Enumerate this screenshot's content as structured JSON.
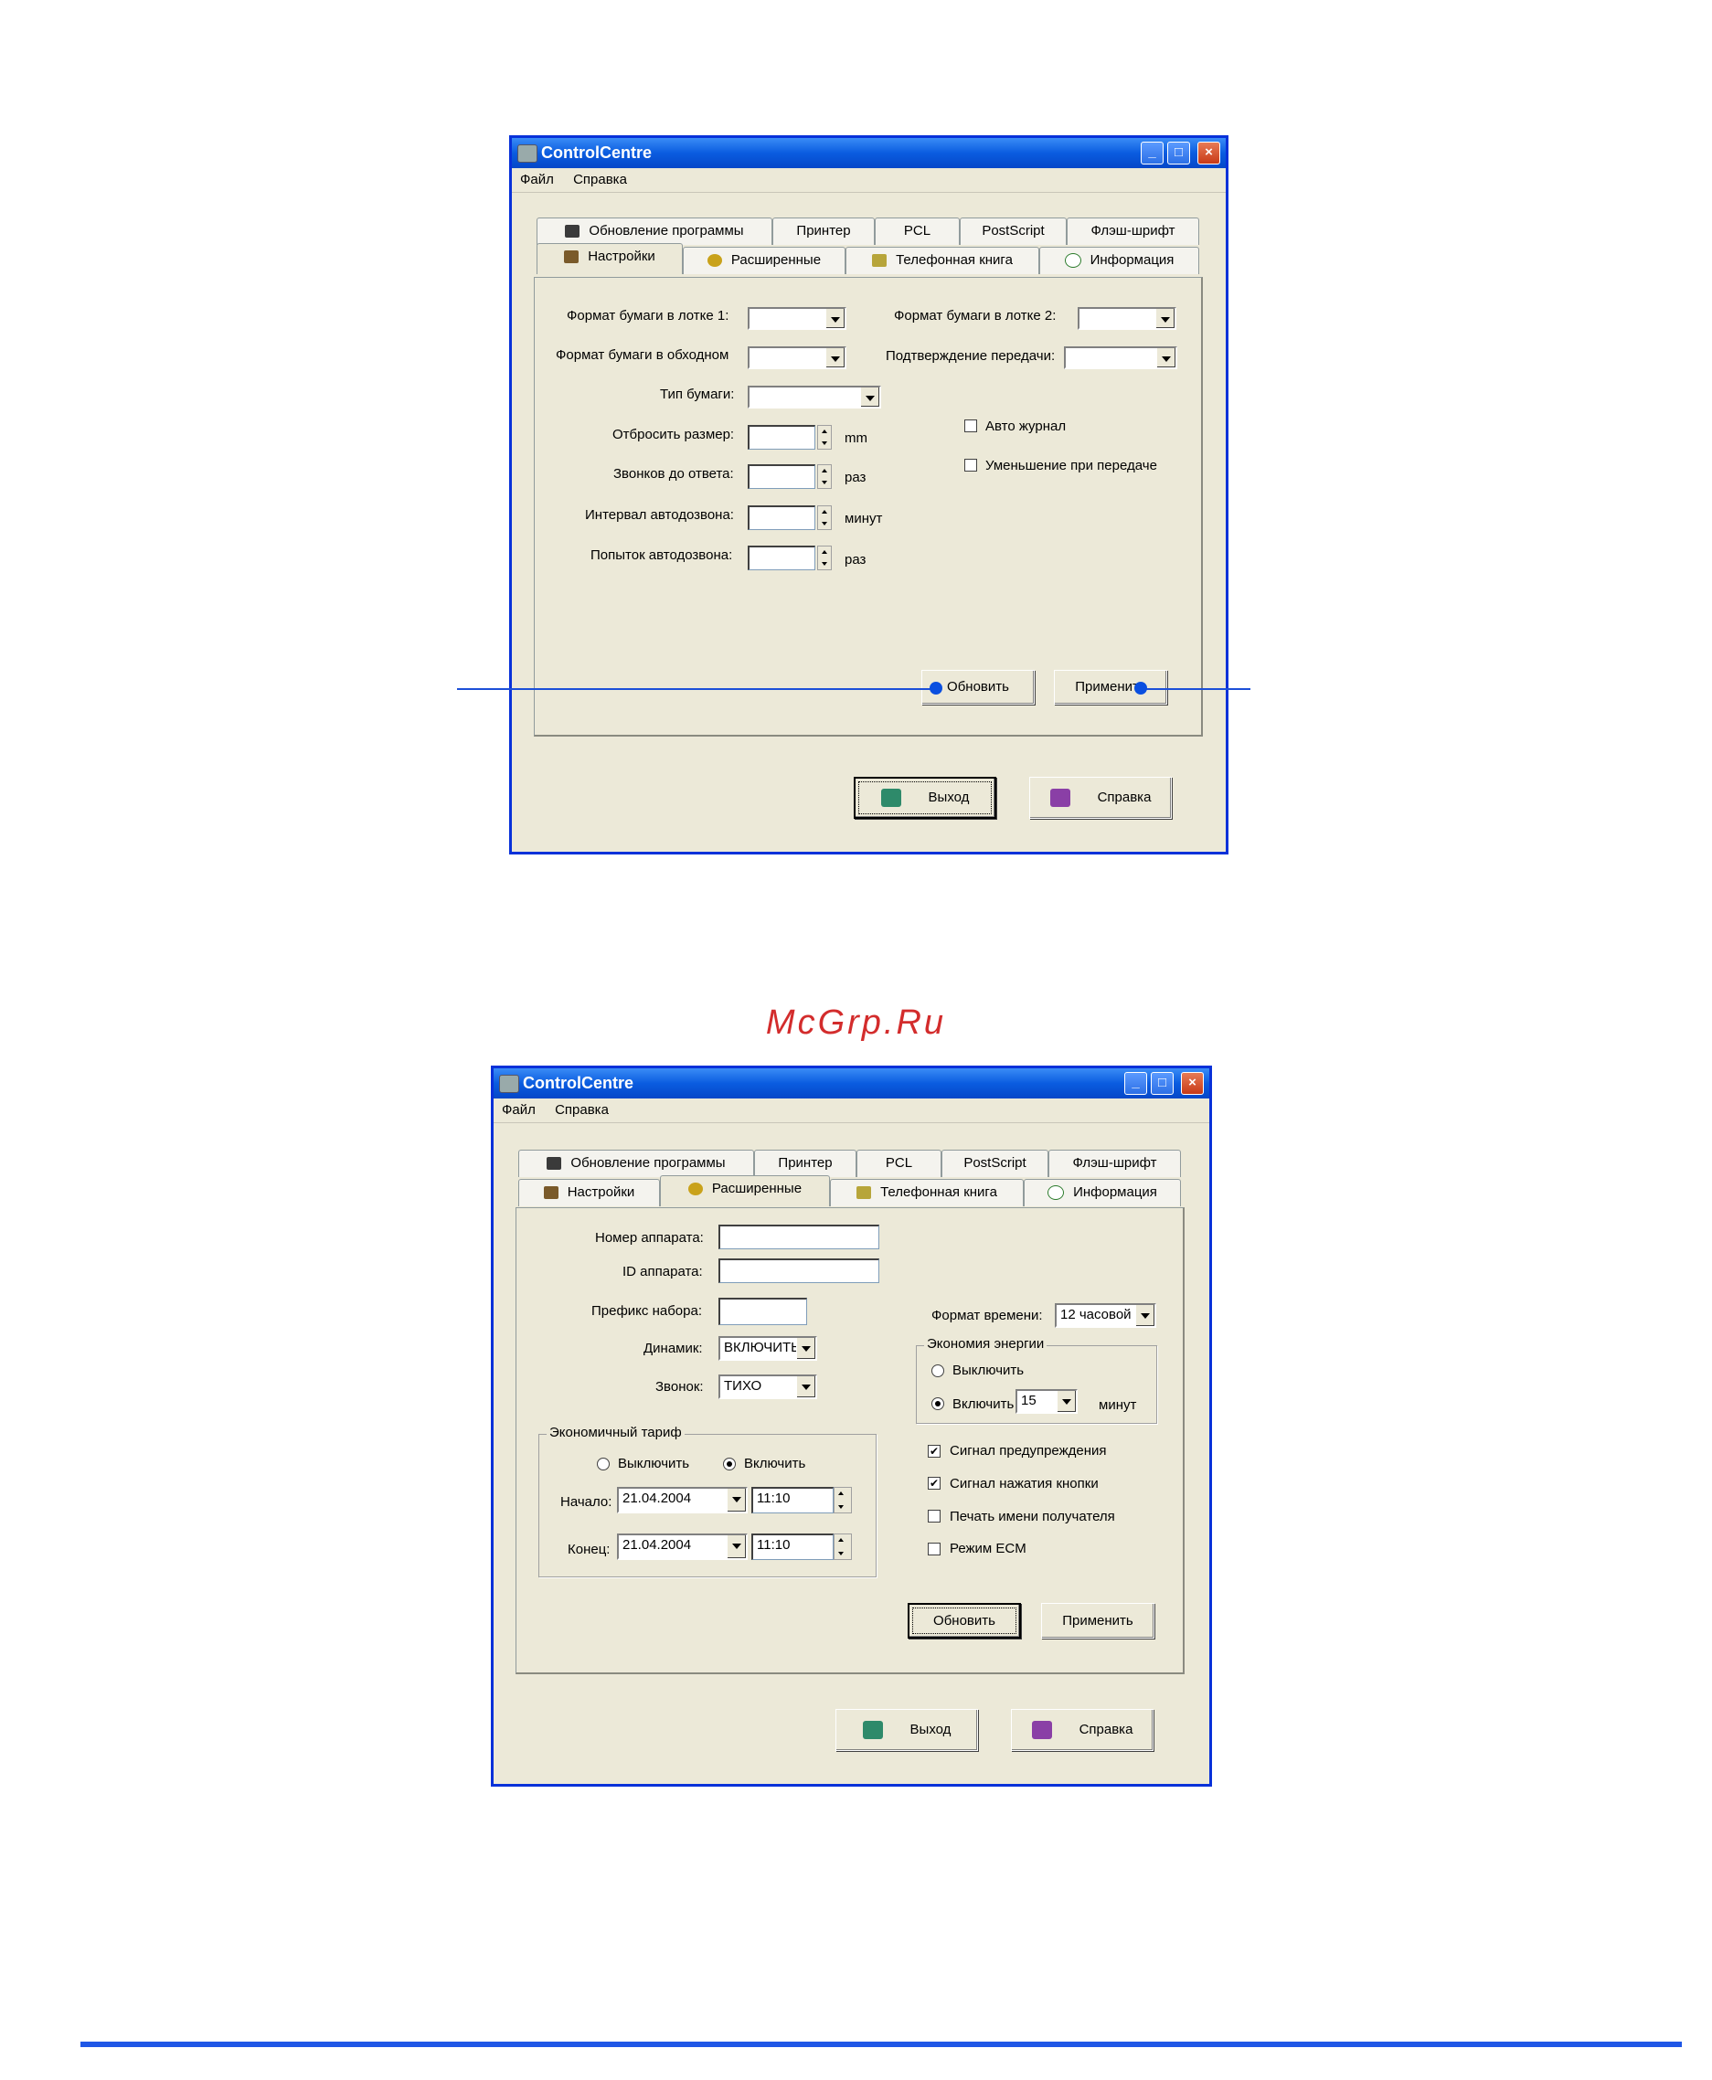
{
  "watermark": "McGrp.Ru",
  "window1": {
    "title": "ControlCentre",
    "menu": [
      "Файл",
      "Справка"
    ],
    "tabs_row1": [
      "Обновление программы",
      "Принтер",
      "PCL",
      "PostScript",
      "Флэш-шрифт"
    ],
    "tabs_row2": [
      "Настройки",
      "Расширенные",
      "Телефонная книга",
      "Информация"
    ],
    "active_tab": "Настройки",
    "labels": {
      "tray1": "Формат бумаги в лотке 1:",
      "tray2": "Формат бумаги в лотке 2:",
      "bypass": "Формат бумаги в обходном",
      "confirm": "Подтверждение передачи:",
      "paper_type": "Тип бумаги:",
      "discard": "Отбросить размер:",
      "rings": "Звонков до ответа:",
      "redial_interval": "Интервал автодозвона:",
      "redial_attempts": "Попыток автодозвона:",
      "unit_mm": "mm",
      "unit_times1": "раз",
      "unit_min": "минут",
      "unit_times2": "раз",
      "auto_journal": "Авто журнал",
      "reduce_on_send": "Уменьшение при передаче"
    },
    "buttons": {
      "refresh": "Обновить",
      "apply": "Применить",
      "exit": "Выход",
      "help": "Справка"
    }
  },
  "window2": {
    "title": "ControlCentre",
    "menu": [
      "Файл",
      "Справка"
    ],
    "tabs_row1": [
      "Обновление программы",
      "Принтер",
      "PCL",
      "PostScript",
      "Флэш-шрифт"
    ],
    "tabs_row2": [
      "Настройки",
      "Расширенные",
      "Телефонная книга",
      "Информация"
    ],
    "active_tab": "Расширенные",
    "labels": {
      "device_number": "Номер аппарата:",
      "device_id": "ID аппарата:",
      "dial_prefix": "Префикс набора:",
      "speaker": "Динамик:",
      "ringer": "Звонок:",
      "time_format": "Формат времени:",
      "power_save": "Экономия энергии",
      "ps_off": "Выключить",
      "ps_on": "Включить",
      "ps_unit": "минут",
      "tariff": "Экономичный тариф",
      "tariff_off": "Выключить",
      "tariff_on": "Включить",
      "start": "Начало:",
      "end": "Конец:",
      "warning_signal": "Сигнал предупреждения",
      "key_signal": "Сигнал нажатия кнопки",
      "print_recipient": "Печать имени получателя",
      "ecm": "Режим ECM"
    },
    "values": {
      "speaker": "ВКЛЮЧИТЬ",
      "ringer": "ТИХО",
      "time_format": "12 часовой",
      "ps_minutes": "15",
      "start_date": "21.04.2004",
      "start_time": "11:10",
      "end_date": "21.04.2004",
      "end_time": "11:10"
    },
    "checks": {
      "warning_signal": true,
      "key_signal": true,
      "print_recipient": false,
      "ecm": false
    },
    "buttons": {
      "refresh": "Обновить",
      "apply": "Применить",
      "exit": "Выход",
      "help": "Справка"
    }
  }
}
